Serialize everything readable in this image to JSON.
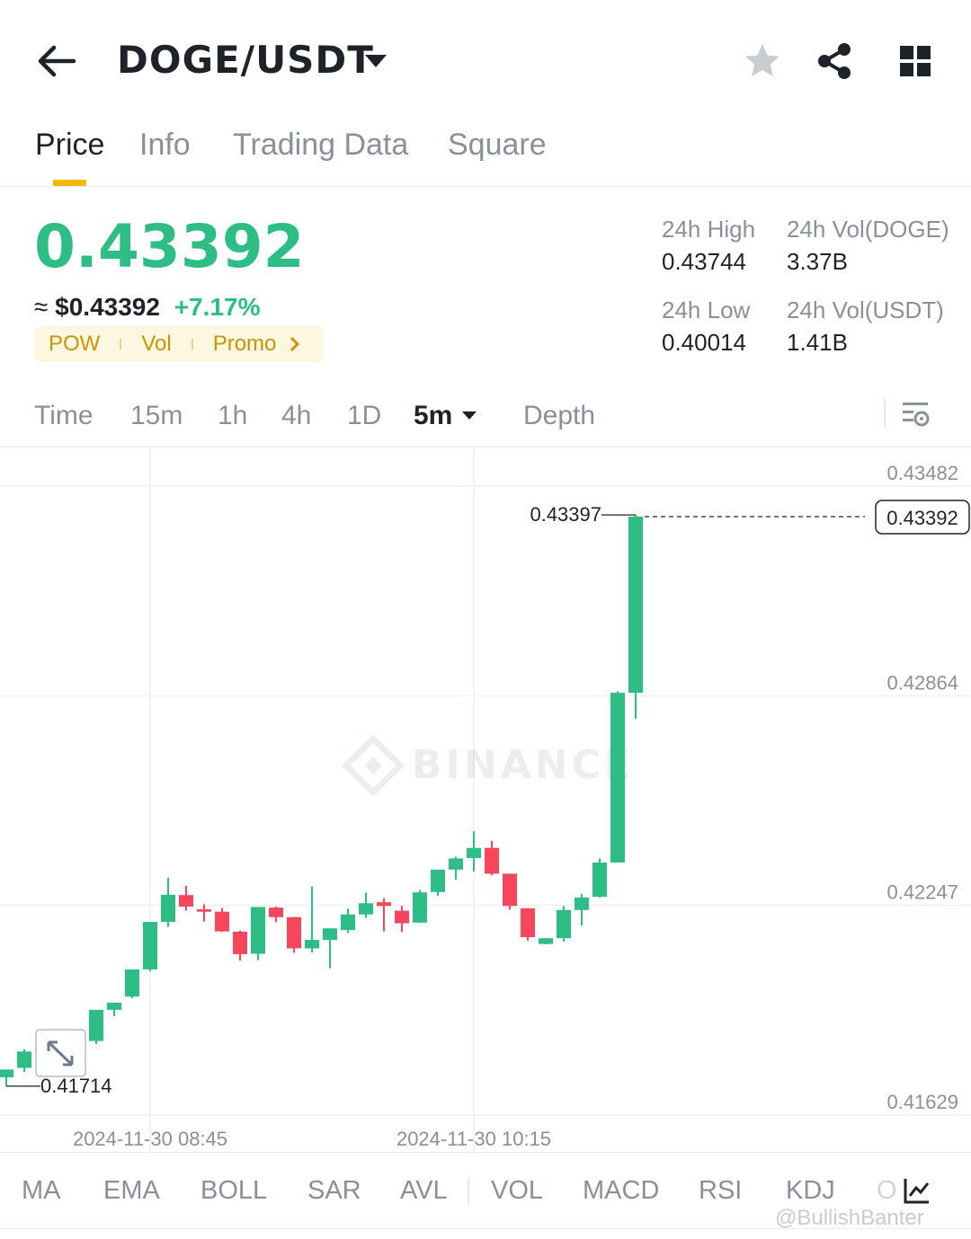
{
  "header": {
    "pair": "DOGE/USDT",
    "icons": [
      "back-arrow-icon",
      "caret-down-icon",
      "star-icon",
      "share-icon",
      "grid-icon"
    ]
  },
  "tabs": [
    {
      "label": "Price",
      "active": true
    },
    {
      "label": "Info",
      "active": false
    },
    {
      "label": "Trading Data",
      "active": false
    },
    {
      "label": "Square",
      "active": false
    }
  ],
  "summary": {
    "last_price": "0.43392",
    "approx_prefix": "≈",
    "approx_usd": "$0.43392",
    "change_pct": "+7.17%",
    "tags": [
      "POW",
      "Vol",
      "Promo"
    ],
    "high_label": "24h High",
    "high_value": "0.43744",
    "low_label": "24h Low",
    "low_value": "0.40014",
    "vol_base_label": "24h Vol(DOGE)",
    "vol_base_value": "3.37B",
    "vol_quote_label": "24h Vol(USDT)",
    "vol_quote_value": "1.41B"
  },
  "intervals": {
    "items": [
      "Time",
      "15m",
      "1h",
      "4h",
      "1D",
      "5m",
      "Depth"
    ],
    "active": "5m"
  },
  "indicators": [
    "MA",
    "EMA",
    "BOLL",
    "SAR",
    "AVL",
    "VOL",
    "MACD",
    "RSI",
    "KDJ",
    "O"
  ],
  "watermark": "@BullishBanter",
  "colors": {
    "up": "#2ebd85",
    "down": "#f6465d",
    "accent": "#f0b90b"
  },
  "chart_data": {
    "type": "candlestick",
    "watermark": "BINANCE",
    "y_ticks": [
      "0.43482",
      "0.42864",
      "0.42247",
      "0.41629"
    ],
    "y_tick_values": [
      0.43482,
      0.42864,
      0.42247,
      0.41629
    ],
    "x_ticks": [
      "2024-11-30 08:45",
      "2024-11-30 10:15"
    ],
    "x_tick_indices": [
      8,
      26
    ],
    "last_price_label": "0.43392",
    "last_price": 0.43392,
    "max_label": "0.43397",
    "max_value": 0.43397,
    "min_label": "0.41714",
    "min_value": 0.41714,
    "candles": [
      {
        "o": 0.4174,
        "h": 0.41763,
        "l": 0.41714,
        "c": 0.41763
      },
      {
        "o": 0.41768,
        "h": 0.41823,
        "l": 0.41756,
        "c": 0.41816
      },
      {
        "o": 0.41822,
        "h": 0.41856,
        "l": 0.41811,
        "c": 0.41827
      },
      {
        "o": 0.4183,
        "h": 0.41851,
        "l": 0.41811,
        "c": 0.41844
      },
      {
        "o": 0.41844,
        "h": 0.41849,
        "l": 0.41829,
        "c": 0.41846
      },
      {
        "o": 0.41847,
        "h": 0.41918,
        "l": 0.41838,
        "c": 0.41939
      },
      {
        "o": 0.41939,
        "h": 0.4196,
        "l": 0.4192,
        "c": 0.4196
      },
      {
        "o": 0.41978,
        "h": 0.42054,
        "l": 0.41973,
        "c": 0.42058
      },
      {
        "o": 0.42058,
        "h": 0.42164,
        "l": 0.42052,
        "c": 0.42198
      },
      {
        "o": 0.42198,
        "h": 0.42328,
        "l": 0.42183,
        "c": 0.42278
      },
      {
        "o": 0.42277,
        "h": 0.42304,
        "l": 0.42231,
        "c": 0.42243
      },
      {
        "o": 0.42235,
        "h": 0.4225,
        "l": 0.42199,
        "c": 0.42228
      },
      {
        "o": 0.42228,
        "h": 0.42239,
        "l": 0.42169,
        "c": 0.4217
      },
      {
        "o": 0.42169,
        "h": 0.42172,
        "l": 0.42084,
        "c": 0.42103
      },
      {
        "o": 0.42104,
        "h": 0.4224,
        "l": 0.42085,
        "c": 0.42242
      },
      {
        "o": 0.4224,
        "h": 0.42243,
        "l": 0.42197,
        "c": 0.42212
      },
      {
        "o": 0.42212,
        "h": 0.42213,
        "l": 0.42107,
        "c": 0.4212
      },
      {
        "o": 0.4212,
        "h": 0.42303,
        "l": 0.42108,
        "c": 0.42145
      },
      {
        "o": 0.42145,
        "h": 0.42179,
        "l": 0.42061,
        "c": 0.42179
      },
      {
        "o": 0.42174,
        "h": 0.42237,
        "l": 0.42165,
        "c": 0.4222
      },
      {
        "o": 0.4222,
        "h": 0.42284,
        "l": 0.4221,
        "c": 0.42253
      },
      {
        "o": 0.42256,
        "h": 0.42268,
        "l": 0.4217,
        "c": 0.42245
      },
      {
        "o": 0.42231,
        "h": 0.42245,
        "l": 0.42168,
        "c": 0.42194
      },
      {
        "o": 0.42196,
        "h": 0.42292,
        "l": 0.42195,
        "c": 0.42285
      },
      {
        "o": 0.42286,
        "h": 0.42349,
        "l": 0.42275,
        "c": 0.42352
      },
      {
        "o": 0.42352,
        "h": 0.4239,
        "l": 0.42322,
        "c": 0.42385
      },
      {
        "o": 0.42386,
        "h": 0.42465,
        "l": 0.42347,
        "c": 0.42416
      },
      {
        "o": 0.42416,
        "h": 0.42437,
        "l": 0.42335,
        "c": 0.4234
      },
      {
        "o": 0.4234,
        "h": 0.4234,
        "l": 0.42234,
        "c": 0.42245
      },
      {
        "o": 0.42238,
        "h": 0.42238,
        "l": 0.42143,
        "c": 0.42153
      },
      {
        "o": 0.42133,
        "h": 0.42145,
        "l": 0.42132,
        "c": 0.4215
      },
      {
        "o": 0.4215,
        "h": 0.42245,
        "l": 0.4214,
        "c": 0.42233
      },
      {
        "o": 0.42233,
        "h": 0.4228,
        "l": 0.42187,
        "c": 0.4227
      },
      {
        "o": 0.42272,
        "h": 0.42385,
        "l": 0.4227,
        "c": 0.42373
      },
      {
        "o": 0.42373,
        "h": 0.42877,
        "l": 0.42373,
        "c": 0.42873
      },
      {
        "o": 0.42873,
        "h": 0.43397,
        "l": 0.42796,
        "c": 0.43392
      }
    ]
  }
}
